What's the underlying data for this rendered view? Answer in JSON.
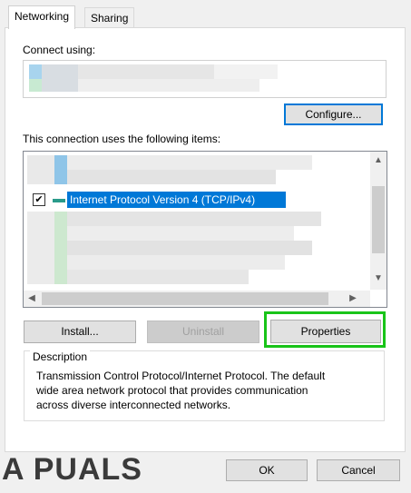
{
  "tabs": [
    {
      "label": "Networking"
    },
    {
      "label": "Sharing"
    }
  ],
  "connect_using_label": "Connect using:",
  "configure_button": "Configure...",
  "items_label": "This connection uses the following items:",
  "selected_item": {
    "label": "Internet Protocol Version 4 (TCP/IPv4)",
    "checked": true
  },
  "buttons": {
    "install": "Install...",
    "uninstall": "Uninstall",
    "properties": "Properties",
    "ok": "OK",
    "cancel": "Cancel"
  },
  "description": {
    "legend": "Description",
    "line1": "Transmission Control Protocol/Internet Protocol. The default",
    "line2": "wide area network protocol that provides communication",
    "line3": "across diverse interconnected networks."
  },
  "watermark": "A PUALS",
  "colors": {
    "selection": "#0078d7",
    "highlight": "#19c419"
  }
}
